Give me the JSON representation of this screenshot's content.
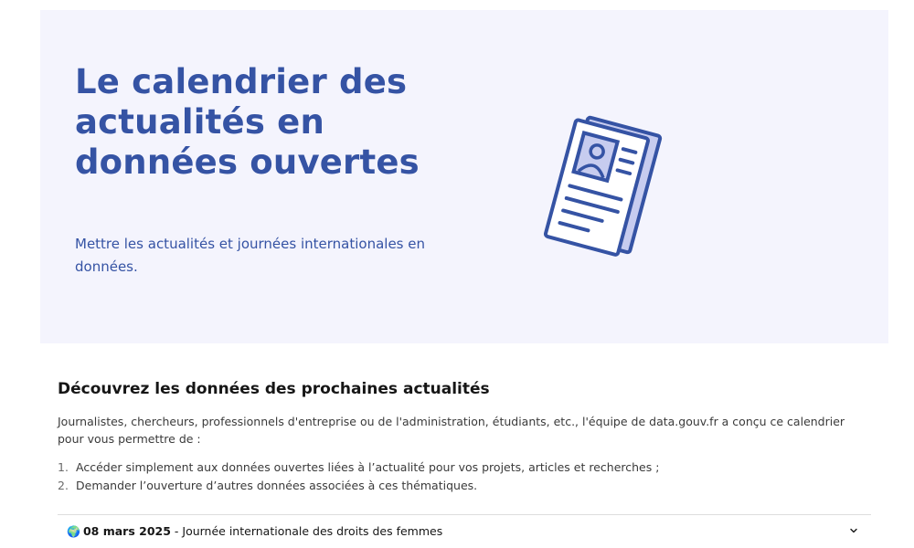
{
  "hero": {
    "title_lines": [
      "Le calendrier des",
      "actualités en",
      "données ouvertes"
    ],
    "description": "Mettre les actualités et journées internationales en données.",
    "illustration_icon": "newspaper-icon",
    "background_color": "#f4f4fd",
    "accent_color": "#3553a4"
  },
  "section": {
    "title": "Découvrez les données des prochaines actualités",
    "intro": "Journalistes, chercheurs, professionnels d'entreprise ou de l'administration, étudiants, etc., l'équipe de data.gouv.fr a conçu ce calendrier pour vous permettre de :",
    "steps": [
      {
        "num": "1.",
        "text": "Accéder simplement aux données ouvertes liées à l’actualité pour vos projets, articles et recherches ;"
      },
      {
        "num": "2.",
        "text": "Demander l’ouverture d’autres données associées à ces thématiques."
      }
    ]
  },
  "events": [
    {
      "icon": "world-globe-icon",
      "icon_glyph": "🌍",
      "date": "08 mars 2025",
      "label": " - Journée internationale des droits des femmes",
      "expanded": false
    }
  ]
}
